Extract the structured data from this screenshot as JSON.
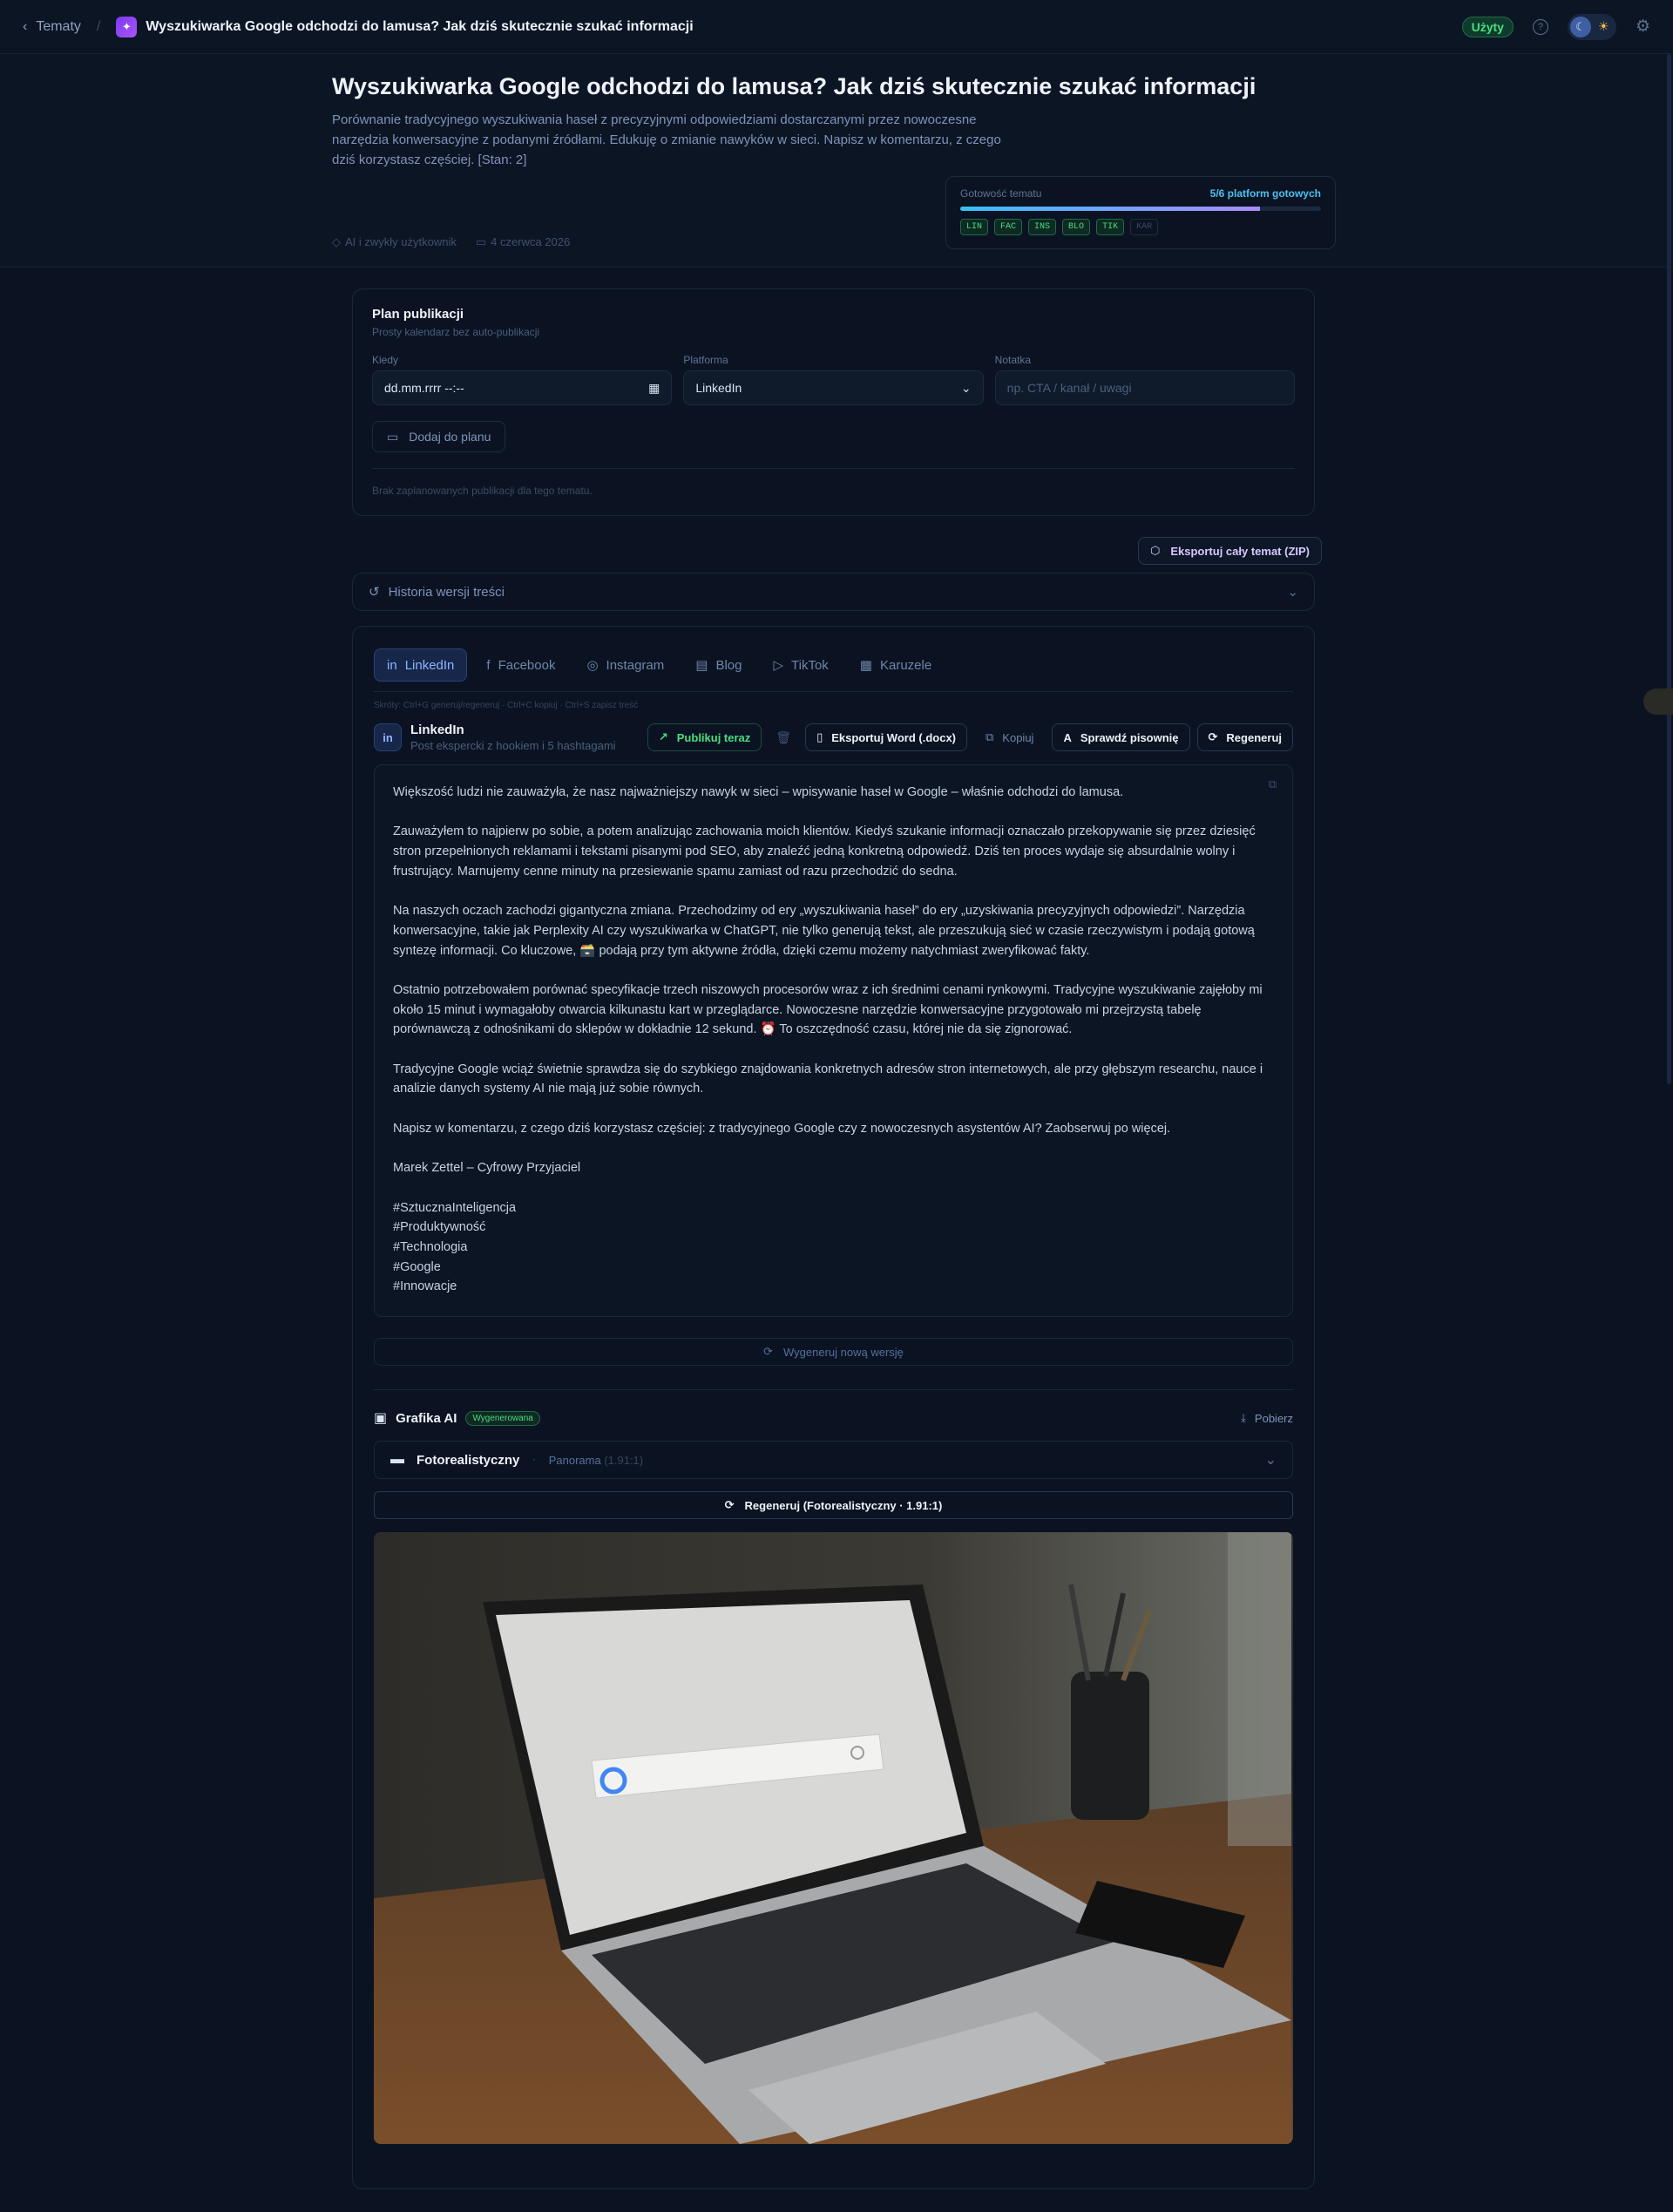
{
  "topbar": {
    "back_label": "Tematy",
    "title": "Wyszukiwarka Google odchodzi do lamusa? Jak dziś skutecznie szukać informacji",
    "status_badge": "Użyty"
  },
  "hero": {
    "title": "Wyszukiwarka Google odchodzi do lamusa? Jak dziś skutecznie szukać informacji",
    "description": "Porównanie tradycyjnego wyszukiwania haseł z precyzyjnymi odpowiedziami dostarczanymi przez nowoczesne narzędzia konwersacyjne z podanymi źródłami. Edukuję o zmianie nawyków w sieci. Napisz w komentarzu, z czego dziś korzystasz częściej. [Stan: 2]",
    "category": "AI i zwykły użytkownik",
    "date": "4 czerwca 2026"
  },
  "readiness": {
    "label": "Gotowość tematu",
    "value": "5/6 platform gotowych",
    "progress": 0.83,
    "chips": [
      {
        "code": "LIN",
        "ready": true
      },
      {
        "code": "FAC",
        "ready": true
      },
      {
        "code": "INS",
        "ready": true
      },
      {
        "code": "BLO",
        "ready": true
      },
      {
        "code": "TIK",
        "ready": true
      },
      {
        "code": "KAR",
        "ready": false
      }
    ]
  },
  "plan": {
    "title": "Plan publikacji",
    "subtitle": "Prosty kalendarz bez auto-publikacji",
    "when_label": "Kiedy",
    "when_value": "dd.mm.rrrr --:--",
    "platform_label": "Platforma",
    "platform_value": "LinkedIn",
    "note_label": "Notatka",
    "note_placeholder": "np. CTA / kanał / uwagi",
    "add_button": "Dodaj do planu",
    "empty_text": "Brak zaplanowanych publikacji dla tego tematu."
  },
  "export_button": "Eksportuj cały temat (ZIP)",
  "history_label": "Historia wersji treści",
  "tabs": [
    "LinkedIn",
    "Facebook",
    "Instagram",
    "Blog",
    "TikTok",
    "Karuzele"
  ],
  "shortcuts": "Skróty: Ctrl+G generuj/regeneruj · Ctrl+C kopiuj · Ctrl+S zapisz treść",
  "post": {
    "platform": "LinkedIn",
    "platform_sub": "Post ekspercki z hookiem i 5 hashtagami",
    "publish": "Publikuj teraz",
    "export_word": "Eksportuj Word (.docx)",
    "copy": "Kopiuj",
    "spellcheck": "Sprawdź pisownię",
    "regenerate": "Regeneruj",
    "paragraphs": [
      "Większość ludzi nie zauważyła, że nasz najważniejszy nawyk w sieci – wpisywanie haseł w Google – właśnie odchodzi do lamusa.",
      "Zauważyłem to najpierw po sobie, a potem analizując zachowania moich klientów. Kiedyś szukanie informacji oznaczało przekopywanie się przez dziesięć stron przepełnionych reklamami i tekstami pisanymi pod SEO, aby znaleźć jedną konkretną odpowiedź. Dziś ten proces wydaje się absurdalnie wolny i frustrujący. Marnujemy cenne minuty na przesiewanie spamu zamiast od razu przechodzić do sedna.",
      "Na naszych oczach zachodzi gigantyczna zmiana. Przechodzimy od ery „wyszukiwania haseł” do ery „uzyskiwania precyzyjnych odpowiedzi”. Narzędzia konwersacyjne, takie jak Perplexity AI czy wyszukiwarka w ChatGPT, nie tylko generują tekst, ale przeszukują sieć w czasie rzeczywistym i podają gotową syntezę informacji. Co kluczowe, 🗃️ podają przy tym aktywne źródła, dzięki czemu możemy natychmiast zweryfikować fakty.",
      "Ostatnio potrzebowałem porównać specyfikacje trzech niszowych procesorów wraz z ich średnimi cenami rynkowymi. Tradycyjne wyszukiwanie zajęłoby mi około 15 minut i wymagałoby otwarcia kilkunastu kart w przeglądarce. Nowoczesne narzędzie konwersacyjne przygotowało mi przejrzystą tabelę porównawczą z odnośnikami do sklepów w dokładnie 12 sekund. ⏰ To oszczędność czasu, której nie da się zignorować.",
      "Tradycyjne Google wciąż świetnie sprawdza się do szybkiego znajdowania konkretnych adresów stron internetowych, ale przy głębszym researchu, nauce i analizie danych systemy AI nie mają już sobie równych.",
      "Napisz w komentarzu, z czego dziś korzystasz częściej: z tradycyjnego Google czy z nowoczesnych asystentów AI? Zaobserwuj po więcej.",
      "Marek Zettel – Cyfrowy Przyjaciel"
    ],
    "hashtags": [
      "#SztucznaInteligencja",
      "#Produktywność",
      "#Technologia",
      "#Google",
      "#Innowacje"
    ],
    "new_version": "Wygeneruj nową wersję"
  },
  "ai_graphic": {
    "title": "Grafika AI",
    "badge": "Wygenerowana",
    "download": "Pobierz",
    "style": "Fotorealistyczny",
    "format": "Panorama",
    "ratio": "(1.91:1)",
    "regen": "Regeneruj (Fotorealistyczny · 1.91:1)",
    "image_alt": "laptop with google search bar on wooden desk"
  },
  "colors": {
    "background": "#0b1322",
    "accent": "#8fb4ff",
    "success": "#4ade80",
    "progress_start": "#38bdf8",
    "progress_end": "#a78bfa"
  }
}
